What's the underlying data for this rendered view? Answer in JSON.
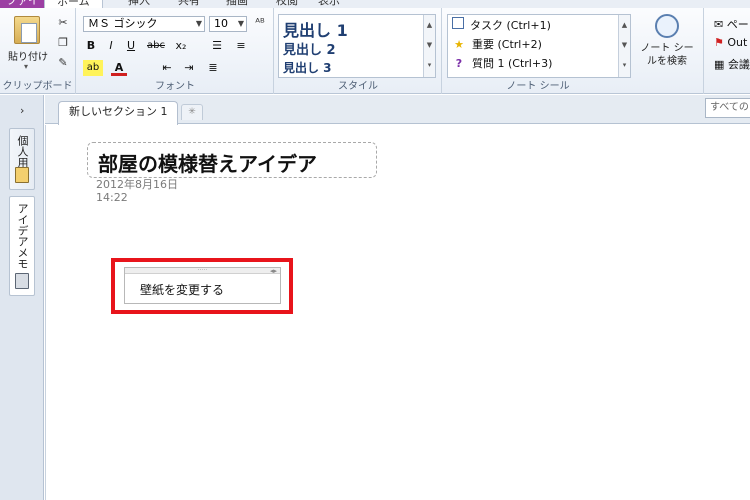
{
  "menu": {
    "file": "ファイル",
    "tabs": [
      "ホーム",
      "挿入",
      "共有",
      "描画",
      "校閲",
      "表示"
    ]
  },
  "ribbon": {
    "clipboard": {
      "paste_label": "貼り付け",
      "group_label": "クリップボード"
    },
    "font": {
      "font_name": "ＭＳ ゴシック",
      "font_size": "10",
      "bold": "B",
      "italic": "I",
      "underline": "U",
      "strike": "abc",
      "subscript": "x₂",
      "highlight": "ab",
      "font_color": "A",
      "group_label": "フォント"
    },
    "styles": {
      "items": [
        "見出し 1",
        "見出し 2",
        "見出し 3"
      ],
      "group_label": "スタイル"
    },
    "tags": {
      "items": [
        {
          "label": "タスク (Ctrl+1)",
          "icon": "checkbox-icon"
        },
        {
          "label": "重要 (Ctrl+2)",
          "icon": "star-icon"
        },
        {
          "label": "質問 1 (Ctrl+3)",
          "icon": "question-icon"
        }
      ],
      "search_label": "ノート シールを検索",
      "group_label": "ノート シール"
    },
    "outlook": {
      "items": [
        "ペー",
        "Out",
        "会議"
      ]
    }
  },
  "leftnav": {
    "notebooks": [
      "個人用",
      "アイデアメモ"
    ]
  },
  "section_tabs": {
    "active": "新しいセクション 1",
    "search_placeholder": "すべてのノートブックを検索"
  },
  "page": {
    "title": "部屋の模様替えアイデア",
    "date": "2012年8月16日",
    "time": "14:22",
    "note_text": "壁紙を変更する"
  },
  "colors": {
    "highlight_frame": "#e8141b",
    "file_tab": "#9c3fa3",
    "style_text": "#203f72"
  }
}
